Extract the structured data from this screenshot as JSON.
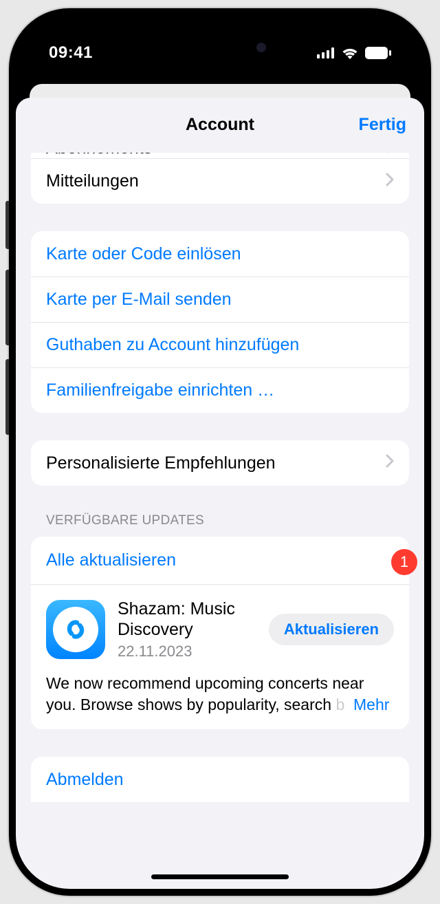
{
  "status": {
    "time": "09:41"
  },
  "header": {
    "title": "Account",
    "done": "Fertig"
  },
  "section1": {
    "subscriptions": "Abonnements",
    "notifications": "Mitteilungen"
  },
  "section2": {
    "redeem": "Karte oder Code einlösen",
    "send_card": "Karte per E-Mail senden",
    "add_funds": "Guthaben zu Account hinzufügen",
    "family": "Familienfreigabe einrichten …"
  },
  "section3": {
    "personalized": "Personalisierte Empfehlungen"
  },
  "updates": {
    "header": "Verfügbare Updates",
    "update_all": "Alle aktualisieren",
    "badge": "1",
    "app": {
      "name": "Shazam: Music Discovery",
      "date": "22.11.2023",
      "button": "Aktualisieren",
      "desc": "We now recommend upcoming concerts near you. Browse shows by popularity, search ",
      "more": "Mehr"
    }
  },
  "signout": "Abmelden"
}
